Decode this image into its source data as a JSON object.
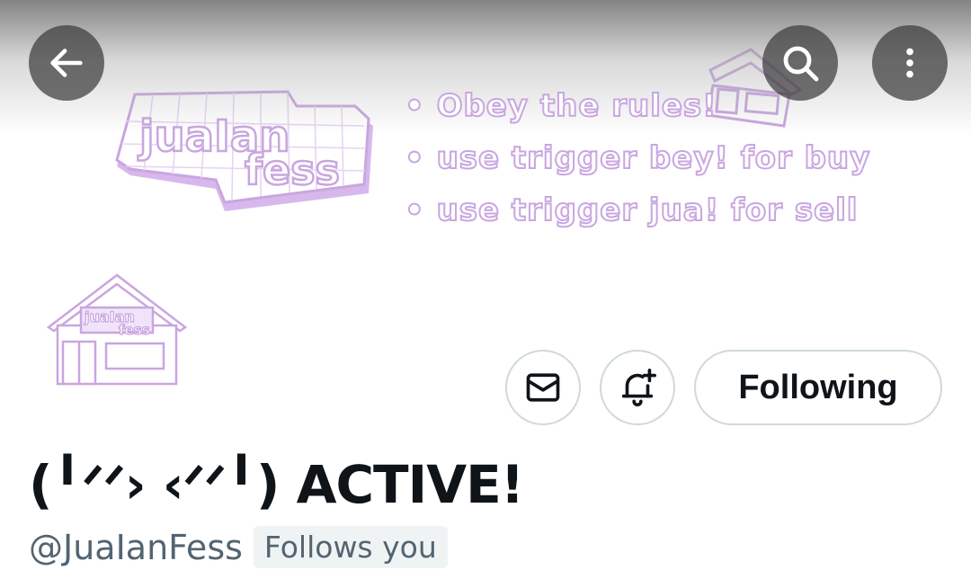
{
  "banner": {
    "logo_line1": "juaIan",
    "logo_line2": "fess",
    "rules": [
      "• Obey the rules!",
      "• use trigger bey! for buy",
      "• use trigger jua! for sell"
    ],
    "accent_color": "#c9a6e0"
  },
  "header": {
    "back_icon": "arrow-left-icon",
    "search_icon": "search-icon",
    "more_icon": "more-vertical-icon"
  },
  "profile": {
    "avatar_text_1": "juaIan",
    "avatar_text_2": "fess",
    "display_name": "(╹ᐟᐟ› ‹ᐟᐟ╹) ACTIVE!",
    "handle": "@JuaIanFess",
    "follows_you": "Follows you"
  },
  "actions": {
    "message_icon": "mail-icon",
    "notify_icon": "bell-plus-icon",
    "following_label": "Following"
  }
}
